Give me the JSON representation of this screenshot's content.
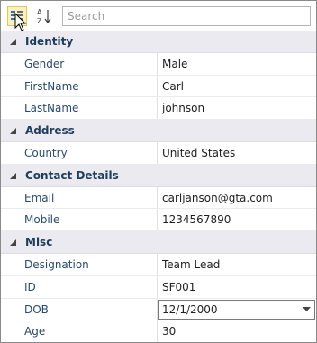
{
  "toolbar": {
    "categorized_icon": "categorized-view-icon",
    "alphabetical_icon": "sort-alphabetical-icon",
    "alpha_top": "A",
    "alpha_bottom": "Z",
    "search_placeholder": "Search"
  },
  "colors": {
    "category_bg": "#eaeaf0",
    "category_text": "#1f3d5a",
    "property_name": "#2b4a6b",
    "selected_button_bg": "#fdf0c0"
  },
  "categories": [
    {
      "label": "Identity",
      "properties": [
        {
          "name": "Gender",
          "value": "Male"
        },
        {
          "name": "FirstName",
          "value": "Carl"
        },
        {
          "name": "LastName",
          "value": "johnson"
        }
      ]
    },
    {
      "label": "Address",
      "properties": [
        {
          "name": "Country",
          "value": "United States"
        }
      ]
    },
    {
      "label": "Contact Details",
      "properties": [
        {
          "name": "Email",
          "value": "carljanson@gta.com"
        },
        {
          "name": "Mobile",
          "value": "1234567890"
        }
      ]
    },
    {
      "label": "Misc",
      "properties": [
        {
          "name": "Designation",
          "value": "Team Lead"
        },
        {
          "name": "ID",
          "value": "SF001"
        },
        {
          "name": "DOB",
          "value": "12/1/2000"
        },
        {
          "name": "Age",
          "value": "30"
        }
      ]
    }
  ]
}
